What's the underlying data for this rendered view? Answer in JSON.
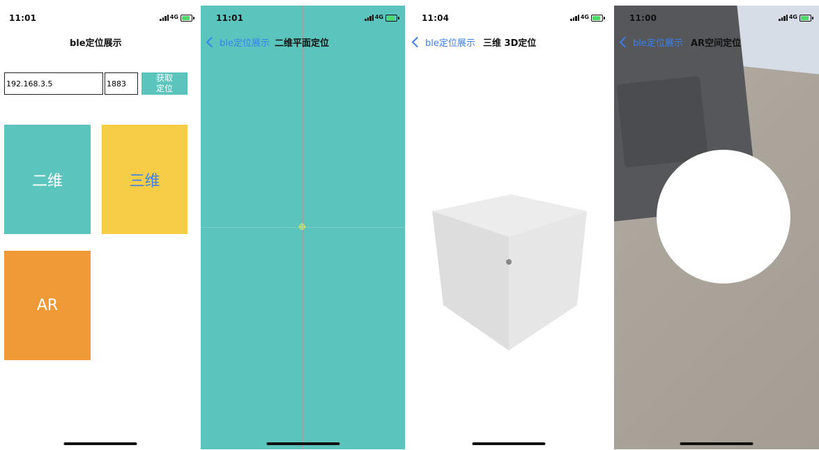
{
  "screens": [
    {
      "status": {
        "time": "11:01",
        "network": "4G"
      },
      "title": "ble定位展示",
      "ip_value": "192.168.3.5",
      "port_value": "1883",
      "get_button": "获取\n定位",
      "tiles": {
        "two_d": "二维",
        "three_d": "三维",
        "ar": "AR"
      }
    },
    {
      "status": {
        "time": "11:01",
        "network": "4G"
      },
      "back_label": "ble定位展示",
      "title": "二维平面定位"
    },
    {
      "status": {
        "time": "11:04",
        "network": "4G"
      },
      "back_label": "ble定位展示",
      "title": "三维 3D定位"
    },
    {
      "status": {
        "time": "11:00",
        "network": "4G"
      },
      "back_label": "ble定位展示",
      "title": "AR空间定位"
    }
  ],
  "colors": {
    "accent": "#5bc5bd",
    "yellow": "#f6cd46",
    "orange": "#ef9a37",
    "link": "#3a80f0"
  },
  "icons": [
    "signal-icon",
    "battery-icon",
    "chevron-left-icon",
    "crosshair-icon"
  ]
}
